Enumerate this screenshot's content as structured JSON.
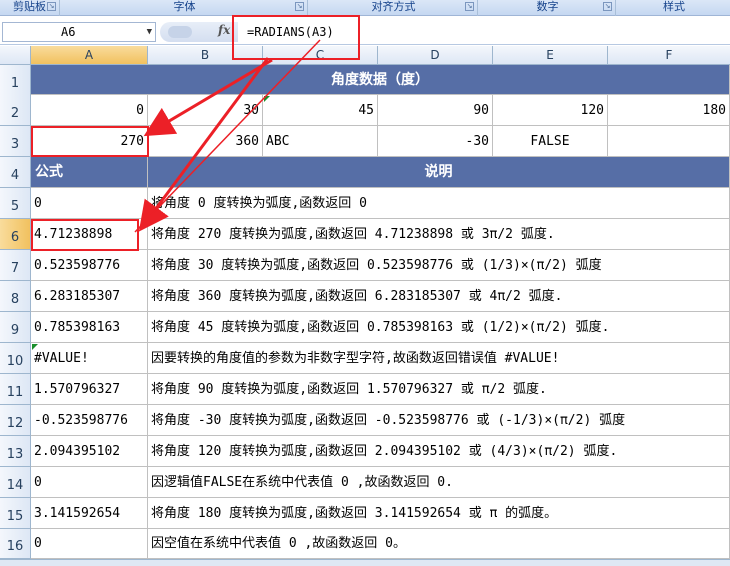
{
  "ribbon": {
    "groups": [
      "剪贴板",
      "字体",
      "对齐方式",
      "数字",
      "样式"
    ]
  },
  "formula_bar": {
    "name_box": "A6",
    "fx_label": "fx",
    "formula": "=RADIANS(A3)"
  },
  "columns": [
    "A",
    "B",
    "C",
    "D",
    "E",
    "F"
  ],
  "rows": [
    "1",
    "2",
    "3",
    "4",
    "5",
    "6",
    "7",
    "8",
    "9",
    "10",
    "11",
    "12",
    "13",
    "14",
    "15",
    "16"
  ],
  "sheet": {
    "title": "角度数据（度）",
    "row2": [
      "0",
      "30",
      "45",
      "90",
      "120",
      "180"
    ],
    "row3": [
      "270",
      "360",
      "ABC",
      "-30",
      "FALSE",
      ""
    ],
    "header_formula": "公式",
    "header_desc": "说明",
    "results": [
      {
        "value": "0",
        "desc": "将角度 0 度转换为弧度,函数返回 0"
      },
      {
        "value": "4.71238898",
        "desc": "将角度 270 度转换为弧度,函数返回 4.71238898  或 3π/2 弧度."
      },
      {
        "value": "0.523598776",
        "desc": "将角度 30 度转换为弧度,函数返回 0.523598776  或 (1/3)×(π/2) 弧度"
      },
      {
        "value": "6.283185307",
        "desc": "将角度 360 度转换为弧度,函数返回 6.283185307  或 4π/2 弧度."
      },
      {
        "value": "0.785398163",
        "desc": "将角度 45 度转换为弧度,函数返回 0.785398163  或 (1/2)×(π/2) 弧度."
      },
      {
        "value": "#VALUE!",
        "desc": "因要转换的角度值的参数为非数字型字符,故函数返回错误值 #VALUE!"
      },
      {
        "value": "1.570796327",
        "desc": "将角度 90 度转换为弧度,函数返回 1.570796327  或 π/2 弧度."
      },
      {
        "value": "-0.523598776",
        "desc": "将角度 -30 度转换为弧度,函数返回 -0.523598776  或 (-1/3)×(π/2) 弧度"
      },
      {
        "value": "2.094395102",
        "desc": "将角度 120 度转换为弧度,函数返回 2.094395102  或 (4/3)×(π/2) 弧度."
      },
      {
        "value": "0",
        "desc": "因逻辑值FALSE在系统中代表值 0 ,故函数返回 0."
      },
      {
        "value": "3.141592654",
        "desc": "将角度 180 度转换为弧度,函数返回 3.141592654 或 π 的弧度。"
      },
      {
        "value": "0",
        "desc": "因空值在系统中代表值 0 ,故函数返回 0。"
      }
    ]
  },
  "colors": {
    "header_bg": "#566ea6",
    "annotation_red": "#ec2027",
    "selection_orange": "#f1c15f"
  }
}
